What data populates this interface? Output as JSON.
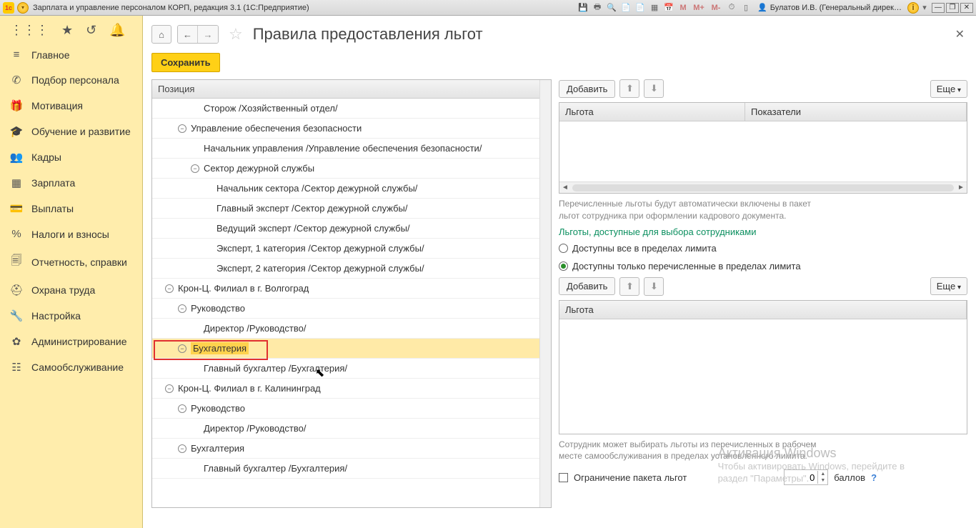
{
  "titlebar": {
    "title": "Зарплата и управление персоналом КОРП, редакция 3.1  (1С:Предприятие)",
    "m_labels": [
      "M",
      "M+",
      "M-"
    ],
    "user": "Булатов И.В. (Генеральный дирек…"
  },
  "sidebar": {
    "items": [
      {
        "icon": "≡",
        "label": "Главное"
      },
      {
        "icon": "✆",
        "label": "Подбор персонала"
      },
      {
        "icon": "🎁",
        "label": "Мотивация"
      },
      {
        "icon": "🎓",
        "label": "Обучение и развитие"
      },
      {
        "icon": "👥",
        "label": "Кадры"
      },
      {
        "icon": "▦",
        "label": "Зарплата"
      },
      {
        "icon": "💳",
        "label": "Выплаты"
      },
      {
        "icon": "%",
        "label": "Налоги и взносы"
      },
      {
        "icon": "🗐",
        "label": "Отчетность, справки"
      },
      {
        "icon": "⛑",
        "label": "Охрана труда"
      },
      {
        "icon": "🔧",
        "label": "Настройка"
      },
      {
        "icon": "✿",
        "label": "Администрирование"
      },
      {
        "icon": "☷",
        "label": "Самообслуживание"
      }
    ]
  },
  "page": {
    "title": "Правила предоставления льгот",
    "save": "Сохранить"
  },
  "tree": {
    "header": "Позиция",
    "rows": [
      {
        "indent": 72,
        "toggle": false,
        "label": "Сторож /Хозяйственный отдел/"
      },
      {
        "indent": 36,
        "toggle": true,
        "label": "Управление обеспечения безопасности"
      },
      {
        "indent": 72,
        "toggle": false,
        "label": "Начальник управления /Управление обеспечения безопасности/"
      },
      {
        "indent": 54,
        "toggle": true,
        "label": "Сектор дежурной службы"
      },
      {
        "indent": 90,
        "toggle": false,
        "label": "Начальник сектора /Сектор дежурной службы/"
      },
      {
        "indent": 90,
        "toggle": false,
        "label": "Главный эксперт /Сектор дежурной службы/"
      },
      {
        "indent": 90,
        "toggle": false,
        "label": "Ведущий эксперт /Сектор дежурной службы/"
      },
      {
        "indent": 90,
        "toggle": false,
        "label": "Эксперт, 1 категория /Сектор дежурной службы/"
      },
      {
        "indent": 90,
        "toggle": false,
        "label": "Эксперт, 2 категория /Сектор дежурной службы/"
      },
      {
        "indent": 18,
        "toggle": true,
        "label": "Крон-Ц. Филиал в г. Волгоград"
      },
      {
        "indent": 36,
        "toggle": true,
        "label": "Руководство"
      },
      {
        "indent": 72,
        "toggle": false,
        "label": "Директор /Руководство/"
      },
      {
        "indent": 36,
        "toggle": true,
        "label": "Бухгалтерия",
        "selected": true
      },
      {
        "indent": 72,
        "toggle": false,
        "label": "Главный бухгалтер /Бухгалтерия/"
      },
      {
        "indent": 18,
        "toggle": true,
        "label": "Крон-Ц. Филиал в г. Калининград"
      },
      {
        "indent": 36,
        "toggle": true,
        "label": "Руководство"
      },
      {
        "indent": 72,
        "toggle": false,
        "label": "Директор /Руководство/"
      },
      {
        "indent": 36,
        "toggle": true,
        "label": "Бухгалтерия"
      },
      {
        "indent": 72,
        "toggle": false,
        "label": "Главный бухгалтер /Бухгалтерия/"
      }
    ]
  },
  "right": {
    "add": "Добавить",
    "more": "Еще",
    "grid1_cols": [
      "Льгота",
      "Показатели"
    ],
    "hint1a": "Перечисленные льготы будут автоматически включены в пакет",
    "hint1b": "льгот сотрудника при оформлении кадрового документа.",
    "green": "Льготы, доступные для выбора сотрудниками",
    "radio1": "Доступны все в пределах лимита",
    "radio2": "Доступны только перечисленные в пределах лимита",
    "grid2_col": "Льгота",
    "hint2a": "Сотрудник может выбирать льготы из перечисленных в рабочем",
    "hint2b": "месте самообслуживания в пределах установленного лимита.",
    "limit_label": "Ограничение пакета льгот",
    "limit_value": "0",
    "limit_unit": "баллов"
  },
  "watermark": {
    "title": "Активация Windows",
    "line1": "Чтобы активировать Windows, перейдите в",
    "line2": "раздел \"Параметры\"."
  }
}
